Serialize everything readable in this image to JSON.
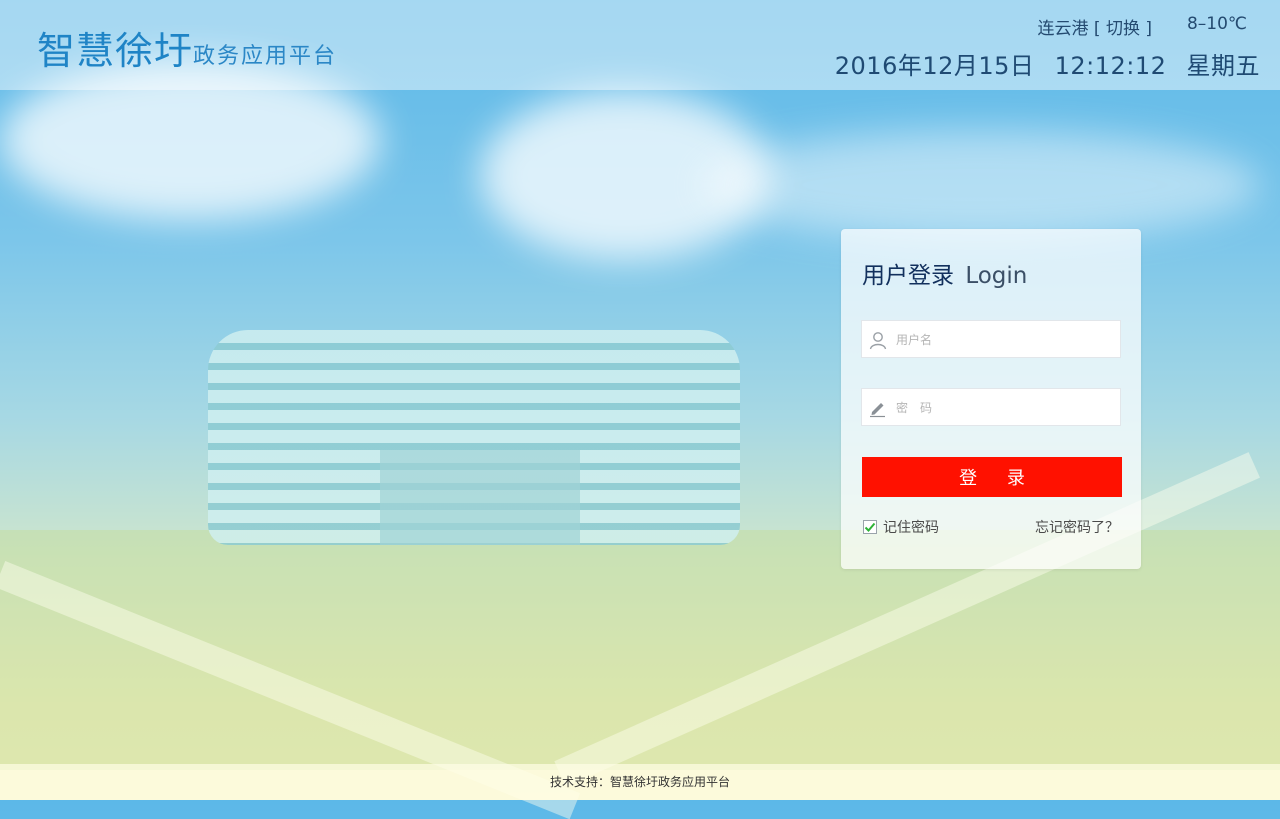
{
  "header": {
    "brand_name": "智慧徐圩",
    "brand_sub": "政务应用平台",
    "city": "连云港",
    "switch_label": "[ 切换 ]",
    "temperature": "8–10℃",
    "date": "2016年12月15日",
    "time": "12:12:12",
    "weekday": "星期五"
  },
  "login": {
    "title_cn": "用户登录",
    "title_en": "Login",
    "username_placeholder": "用户名",
    "username_value": "",
    "password_placeholder": "密　码",
    "password_value": "",
    "submit_label": "登 录",
    "remember_label": "记住密码",
    "remember_checked": true,
    "forgot_label": "忘记密码了？"
  },
  "footer": {
    "text": "技术支持：智慧徐圩政务应用平台"
  },
  "colors": {
    "brand": "#1f84c6",
    "button": "#ff1100",
    "check": "#2db336"
  },
  "icons": [
    "user-icon",
    "pencil-icon",
    "check-icon"
  ]
}
